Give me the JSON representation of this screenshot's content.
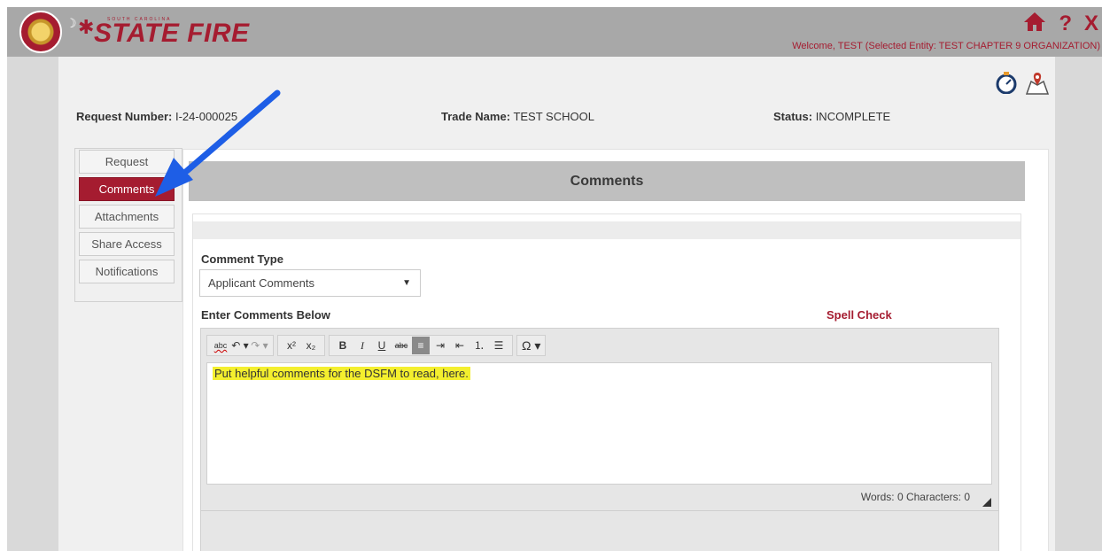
{
  "header": {
    "logo_small_text": "SOUTH CAROLINA",
    "logo_title": "STATE FIRE",
    "welcome": "Welcome, TEST (Selected Entity: TEST CHAPTER 9 ORGANIZATION)",
    "icons": [
      "home-icon",
      "help-icon",
      "close-icon"
    ],
    "help_label": "?",
    "close_label": "X"
  },
  "tools": {
    "icons": [
      "stopwatch-icon",
      "map-pin-icon"
    ]
  },
  "request": {
    "number_label": "Request Number:",
    "number_value": "I-24-000025",
    "trade_name_label": "Trade Name:",
    "trade_name_value": "TEST SCHOOL",
    "status_label": "Status:",
    "status_value": "INCOMPLETE"
  },
  "tabs": [
    {
      "label": "Request",
      "active": false
    },
    {
      "label": "Comments",
      "active": true
    },
    {
      "label": "Attachments",
      "active": false
    },
    {
      "label": "Share Access",
      "active": false
    },
    {
      "label": "Notifications",
      "active": false
    }
  ],
  "panel": {
    "title": "Comments",
    "comment_type_label": "Comment Type",
    "comment_type_value": "Applicant Comments",
    "enter_comments_label": "Enter Comments Below",
    "spell_check": "Spell Check"
  },
  "editor": {
    "text": "Put helpful comments for the DSFM to read, here.",
    "word_count": "Words: 0  Characters: 0",
    "highlight_color": "#f4ef2e"
  },
  "toolbar": {
    "spell": "abc",
    "undo": "↶ ▾",
    "redo": "↷ ▾",
    "superscript": "x²",
    "subscript": "x₂",
    "bold": "B",
    "italic": "I",
    "underline": "U",
    "strike": "abc",
    "align": "≡",
    "indent": "⇥",
    "outdent": "⇤",
    "ordered_list": "⒈",
    "bullet_list": "☰",
    "special_char": "Ω ▾"
  },
  "colors": {
    "brand": "#a51c30",
    "arrow": "#1e5ee6"
  }
}
